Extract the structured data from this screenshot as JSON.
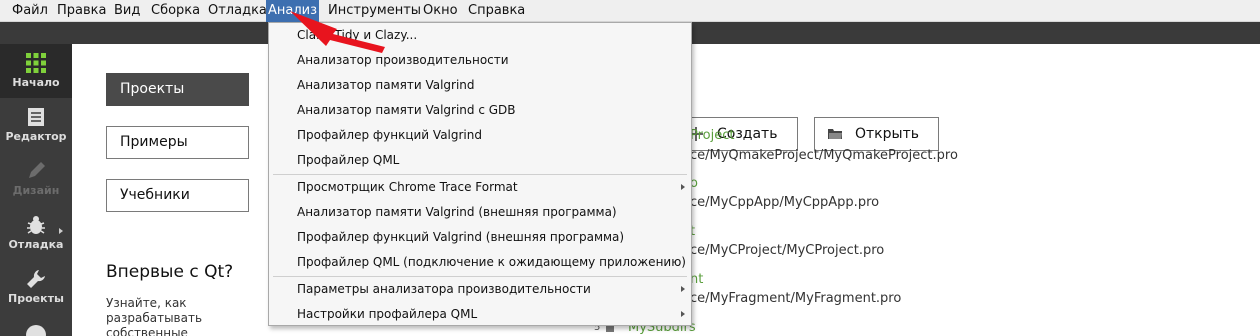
{
  "menubar": {
    "items": [
      "Файл",
      "Правка",
      "Вид",
      "Сборка",
      "Отладка",
      "Анализ",
      "Инструменты",
      "Окно",
      "Справка"
    ]
  },
  "modebar": {
    "items": [
      {
        "label": "Начало",
        "icon": "grid-icon"
      },
      {
        "label": "Редактор",
        "icon": "document-icon"
      },
      {
        "label": "Дизайн",
        "icon": "pen-icon"
      },
      {
        "label": "Отладка",
        "icon": "bug-icon"
      },
      {
        "label": "Проекты",
        "icon": "wrench-icon"
      }
    ]
  },
  "welcome": {
    "side_buttons": [
      "Проекты",
      "Примеры",
      "Учебники"
    ],
    "create_label": "Создать",
    "open_label": "Открыть",
    "first_title": "Впервые с Qt?",
    "first_text": "Узнайте, как разрабатывать собственные"
  },
  "recent": [
    {
      "name": "Project",
      "path": "ce/MyQmakeProject/MyQmakeProject.pro"
    },
    {
      "name": "o",
      "path": "ce/MyCppApp/MyCppApp.pro"
    },
    {
      "name": "t",
      "path": "ce/MyCProject/MyCProject.pro"
    },
    {
      "name": "nt",
      "path": "ce/MyFragment/MyFragment.pro"
    },
    {
      "num": "5",
      "name": "MySubdirs"
    }
  ],
  "dropdown": {
    "items": [
      "Clang-Tidy и Clazy...",
      "Анализатор производительности",
      "Анализатор памяти Valgrind",
      "Анализатор памяти Valgrind с GDB",
      "Профайлер функций Valgrind",
      "Профайлер QML",
      "Просмотрщик Chrome Trace Format",
      "Анализатор памяти Valgrind (внешняя программа)",
      "Профайлер функций Valgrind (внешняя программа)",
      "Профайлер QML (подключение к ожидающему приложению)",
      "Параметры анализатора производительности",
      "Настройки профайлера QML"
    ]
  },
  "colors": {
    "accent": "#3d6fb0",
    "recent_name": "#5a9e3c",
    "annotation": "#e8141e"
  }
}
